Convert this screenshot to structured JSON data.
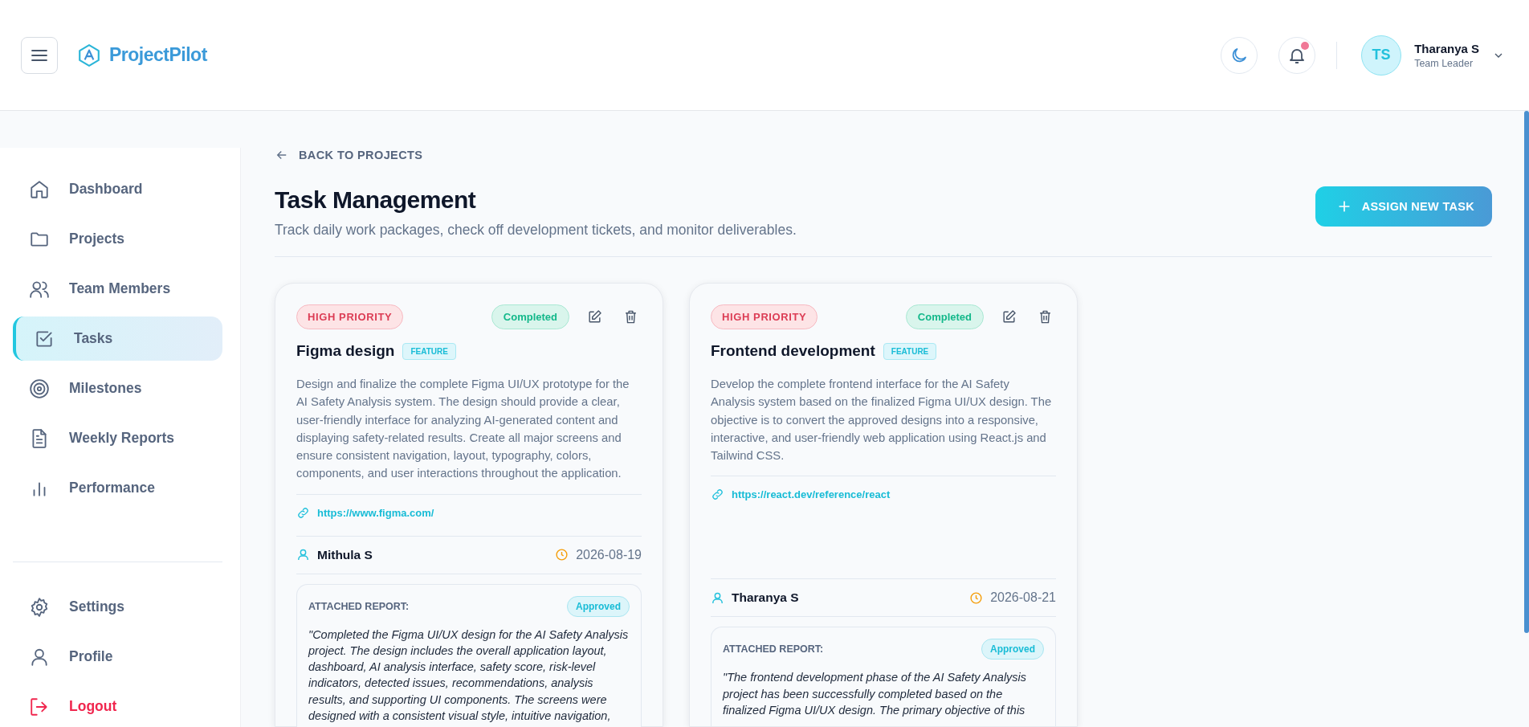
{
  "header": {
    "brand": {
      "first": "Project",
      "second": "Pilot"
    },
    "notifications": {
      "unread": true
    },
    "user": {
      "initials": "TS",
      "name": "Tharanya S",
      "role": "Team Leader"
    }
  },
  "sidebar": {
    "items": [
      {
        "label": "Dashboard",
        "selected": false,
        "kind": "page"
      },
      {
        "label": "Projects",
        "selected": false,
        "kind": "page"
      },
      {
        "label": "Team Members",
        "selected": false,
        "kind": "page"
      },
      {
        "label": "Tasks",
        "selected": true,
        "kind": "page"
      },
      {
        "label": "Milestones",
        "selected": false,
        "kind": "page"
      },
      {
        "label": "Weekly Reports",
        "selected": false,
        "kind": "page"
      },
      {
        "label": "Performance",
        "selected": false,
        "kind": "page"
      }
    ],
    "bottom_items": [
      {
        "label": "Settings",
        "selected": false,
        "kind": "page"
      },
      {
        "label": "Profile",
        "selected": false,
        "kind": "page"
      },
      {
        "label": "Logout",
        "selected": false,
        "kind": "action"
      }
    ]
  },
  "page": {
    "back_link": "BACK TO PROJECTS",
    "title": "Task Management",
    "subtitle": "Track daily work packages, check off development tickets, and monitor deliverables.",
    "action_button": "ASSIGN NEW TASK"
  },
  "tasks": [
    {
      "priority": "HIGH PRIORITY",
      "status": "Completed",
      "title": "Figma design",
      "type": "FEATURE",
      "description": "Design and finalize the complete Figma UI/UX prototype for the AI Safety Analysis system. The design should provide a clear, user-friendly interface for analyzing AI-generated content and displaying safety-related results. Create all major screens and ensure consistent navigation, layout, typography, colors, components, and user interactions throughout the application.",
      "link": "https://www.figma.com/",
      "assignee": "Mithula S",
      "due_date": "2026-08-19",
      "report": {
        "label": "ATTACHED REPORT:",
        "status": "Approved",
        "text": "\"Completed the Figma UI/UX design for the AI Safety Analysis project. The design includes the overall application layout, dashboard, AI analysis interface, safety score, risk-level indicators, detected issues, recommendations, analysis results, and supporting UI components. The screens were designed with a consistent visual style, intuitive navigation,"
      }
    },
    {
      "priority": "HIGH PRIORITY",
      "status": "Completed",
      "title": "Frontend development",
      "type": "FEATURE",
      "description": "Develop the complete frontend interface for the AI Safety Analysis system based on the finalized Figma UI/UX design. The objective is to convert the approved designs into a responsive, interactive, and user-friendly web application using React.js and Tailwind CSS.",
      "link": "https://react.dev/reference/react",
      "assignee": "Tharanya S",
      "due_date": "2026-08-21",
      "report": {
        "label": "ATTACHED REPORT:",
        "status": "Approved",
        "text": "\"The frontend development phase of the AI Safety Analysis project has been successfully completed based on the finalized Figma UI/UX design. The primary objective of this"
      }
    }
  ]
}
